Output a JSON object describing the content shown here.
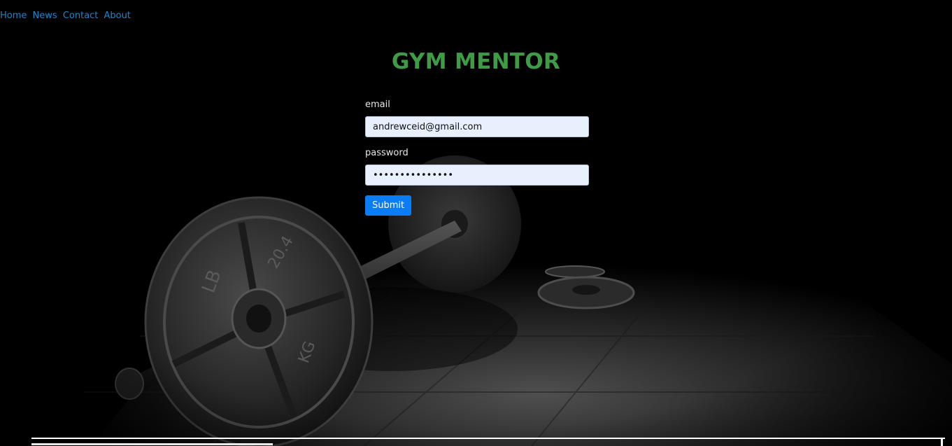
{
  "nav": {
    "items": [
      {
        "label": "Home"
      },
      {
        "label": "News"
      },
      {
        "label": "Contact"
      },
      {
        "label": "About"
      }
    ]
  },
  "header": {
    "title": "GYM MENTOR"
  },
  "form": {
    "email_label": "email",
    "email_value": "andrewceid@gmail.com",
    "password_label": "password",
    "password_value": "•••••••••••••••",
    "submit_label": "Submit"
  },
  "colors": {
    "nav_link": "#1f84c9",
    "title": "#3f9b46",
    "input_bg": "#e8f0fe",
    "submit_bg": "#0a7cf5",
    "page_bg": "#000000"
  },
  "background": {
    "subject": "barbell-image"
  }
}
